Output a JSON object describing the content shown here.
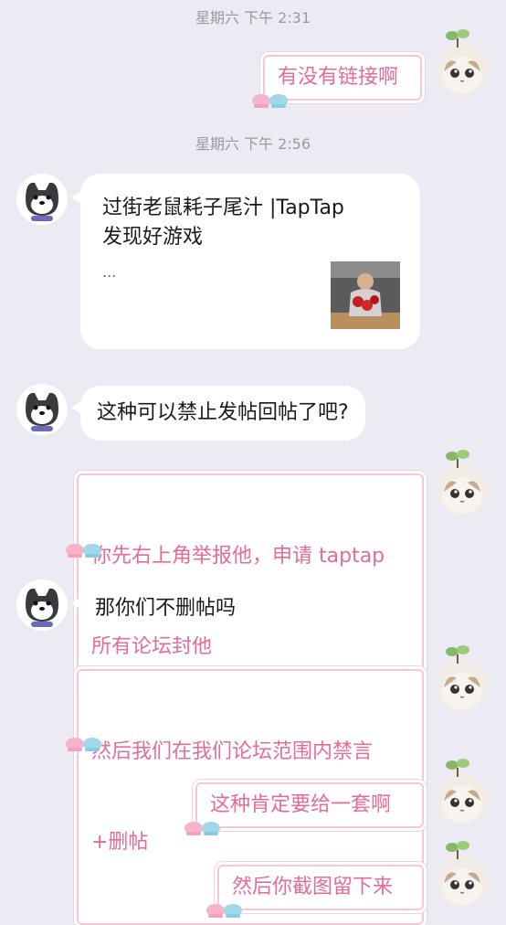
{
  "timestamps": [
    "星期六 下午 2:31",
    "星期六 下午 2:56"
  ],
  "messages": {
    "m1": "有没有链接啊",
    "link_card": {
      "title_line1": "过街老鼠耗子尾汁 |TapTap",
      "title_line2": "发现好游戏",
      "desc": "..."
    },
    "m2": "这种可以禁止发帖回帖了吧?",
    "m3_line1": "你先右上角举报他，申请 taptap",
    "m3_line2": "所有论坛封他",
    "m4": "那你们不删帖吗",
    "m5_line1": "然后我们在我们论坛范围内禁言",
    "m5_line2": "+删帖",
    "m6": "这种肯定要给一套啊",
    "m7": "然后你截图留下来"
  },
  "colors": {
    "background": "#eceaf2",
    "self_text": "#e56b98",
    "bubble_border": "#f7c6d8"
  },
  "icons": {
    "self_avatar": "cat-avatar-icon",
    "other_avatar": "husky-avatar-icon",
    "decor": "teacups-icon"
  }
}
